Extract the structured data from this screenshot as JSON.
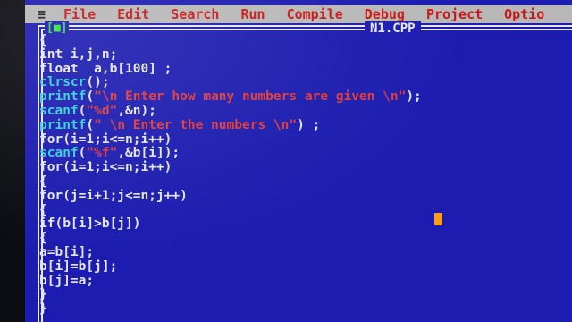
{
  "menu": {
    "system_glyph": "≡",
    "items": [
      "File",
      "Edit",
      "Search",
      "Run",
      "Compile",
      "Debug",
      "Project",
      "Optio"
    ]
  },
  "window": {
    "close_box": "[■]",
    "title": "N1.CPP"
  },
  "code_lines": [
    "{",
    "int i,j,n;",
    "float  a,b[100] ;",
    "clrscr();",
    "printf(\"\\n Enter how many numbers are given \\n\");",
    "scanf(\"%d\",&n);",
    "printf(\" \\n Enter the numbers \\n\") ;",
    "for(i=1;i<=n;i++)",
    "scanf(\"%f\",&b[i]);",
    "for(i=1;i<=n;i++)",
    "{",
    "for(j=i+1;j<=n;j++)",
    "{",
    "if(b[i]>b[j])",
    "{",
    "a=b[i];",
    "b[i]=b[j];",
    "b[j]=a;",
    "}",
    "}"
  ],
  "colors": {
    "background": "#1c1cb0",
    "menubar": "#b8b8b8",
    "string": "#e23a3a",
    "function": "#32d2d2",
    "cursor": "#ff9a1a"
  }
}
